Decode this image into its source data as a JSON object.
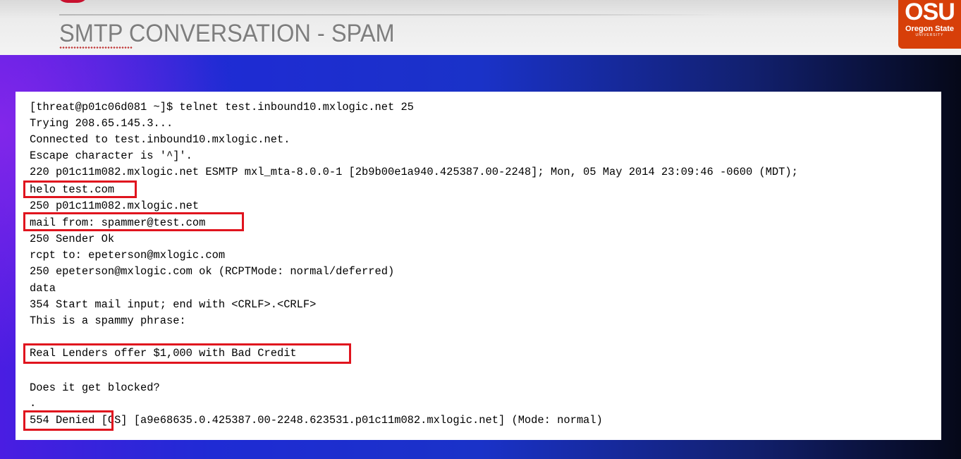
{
  "slide": {
    "title": "SMTP CONVERSATION - SPAM",
    "logo": {
      "mark": "OSU",
      "name": "Oregon State",
      "sub": "UNIVERSITY"
    }
  },
  "terminal": {
    "lines": [
      "[threat@p01c06d081 ~]$ telnet test.inbound10.mxlogic.net 25",
      "Trying 208.65.145.3...",
      "Connected to test.inbound10.mxlogic.net.",
      "Escape character is '^]'.",
      "220 p01c11m082.mxlogic.net ESMTP mxl_mta-8.0.0-1 [2b9b00e1a940.425387.00-2248]; Mon, 05 May 2014 23:09:46 -0600 (MDT);",
      "helo test.com",
      "250 p01c11m082.mxlogic.net",
      "mail from: spammer@test.com",
      "250 Sender Ok",
      "rcpt to: epeterson@mxlogic.com",
      "250 epeterson@mxlogic.com ok (RCPTMode: normal/deferred)",
      "data",
      "354 Start mail input; end with <CRLF>.<CRLF>",
      "This is a spammy phrase:",
      "Real Lenders offer $1,000 with Bad Credit",
      "Does it get blocked?",
      ".",
      "554 Denied [CS] [a9e68635.0.425387.00-2248.623531.p01c11m082.mxlogic.net] (Mode: normal)"
    ]
  },
  "colors": {
    "highlight_border": "#e0141e",
    "osu_orange": "#d73f09",
    "title_gray": "#7e7e7e"
  }
}
